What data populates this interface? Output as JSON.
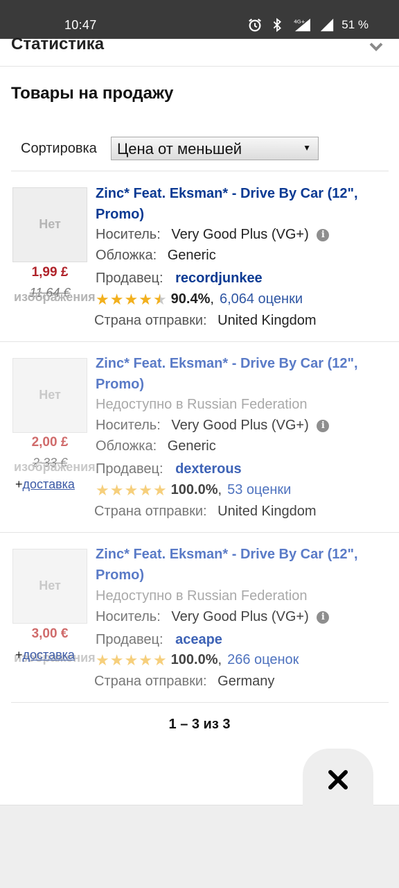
{
  "status_bar": {
    "time": "10:47",
    "network": "4G+",
    "battery": "51 %"
  },
  "stats": {
    "title": "Статистика"
  },
  "section_title": "Товары на продажу",
  "sort": {
    "label": "Сортировка",
    "value": "Цена от меньшей"
  },
  "labels": {
    "no_image_1": "Нет",
    "no_image_2": "изображения",
    "media": "Носитель:",
    "sleeve": "Обложка:",
    "seller": "Продавец:",
    "ships_from": "Страна отправки:",
    "shipping_plus": "+",
    "shipping_link": "доставка",
    "unavailable": "Недоступно в Russian Federation"
  },
  "listings": [
    {
      "title": "Zinc* Feat. Eksman* - Drive By Car (12\", Promo)",
      "media": "Very Good Plus (VG+)",
      "sleeve": "Generic",
      "seller": "recordjunkee",
      "rating_stars": 4.5,
      "rating_pct": "90.4%",
      "ratings_count": "6,064 оценки",
      "ships_from": "United Kingdom",
      "price": "1,99 £",
      "orig_price": "11,64 €"
    },
    {
      "title": "Zinc* Feat. Eksman* - Drive By Car (12\", Promo)",
      "media": "Very Good Plus (VG+)",
      "sleeve": "Generic",
      "seller": "dexterous",
      "rating_stars": 5,
      "rating_pct": "100.0%",
      "ratings_count": "53 оценки",
      "ships_from": "United Kingdom",
      "price": "2,00 £",
      "orig_price": "2,33 €"
    },
    {
      "title": "Zinc* Feat. Eksman* - Drive By Car (12\", Promo)",
      "media": "Very Good Plus (VG+)",
      "seller": "aceape",
      "rating_stars": 5,
      "rating_pct": "100.0%",
      "ratings_count": "266 оценок",
      "ships_from": "Germany",
      "price": "3,00 €"
    }
  ],
  "pagination": "1 – 3 из 3",
  "icons": {
    "alarm": "alarm-icon",
    "bluetooth": "bluetooth-icon",
    "signal": "signal-icon",
    "chevron": "chevron-down-icon",
    "info": "info-icon",
    "star": "star-icon",
    "close": "close-icon"
  },
  "colors": {
    "title_link": "#0b3a93",
    "price": "#b0232a",
    "star": "#f2b01e",
    "status_bar": "#3a3a3a"
  }
}
